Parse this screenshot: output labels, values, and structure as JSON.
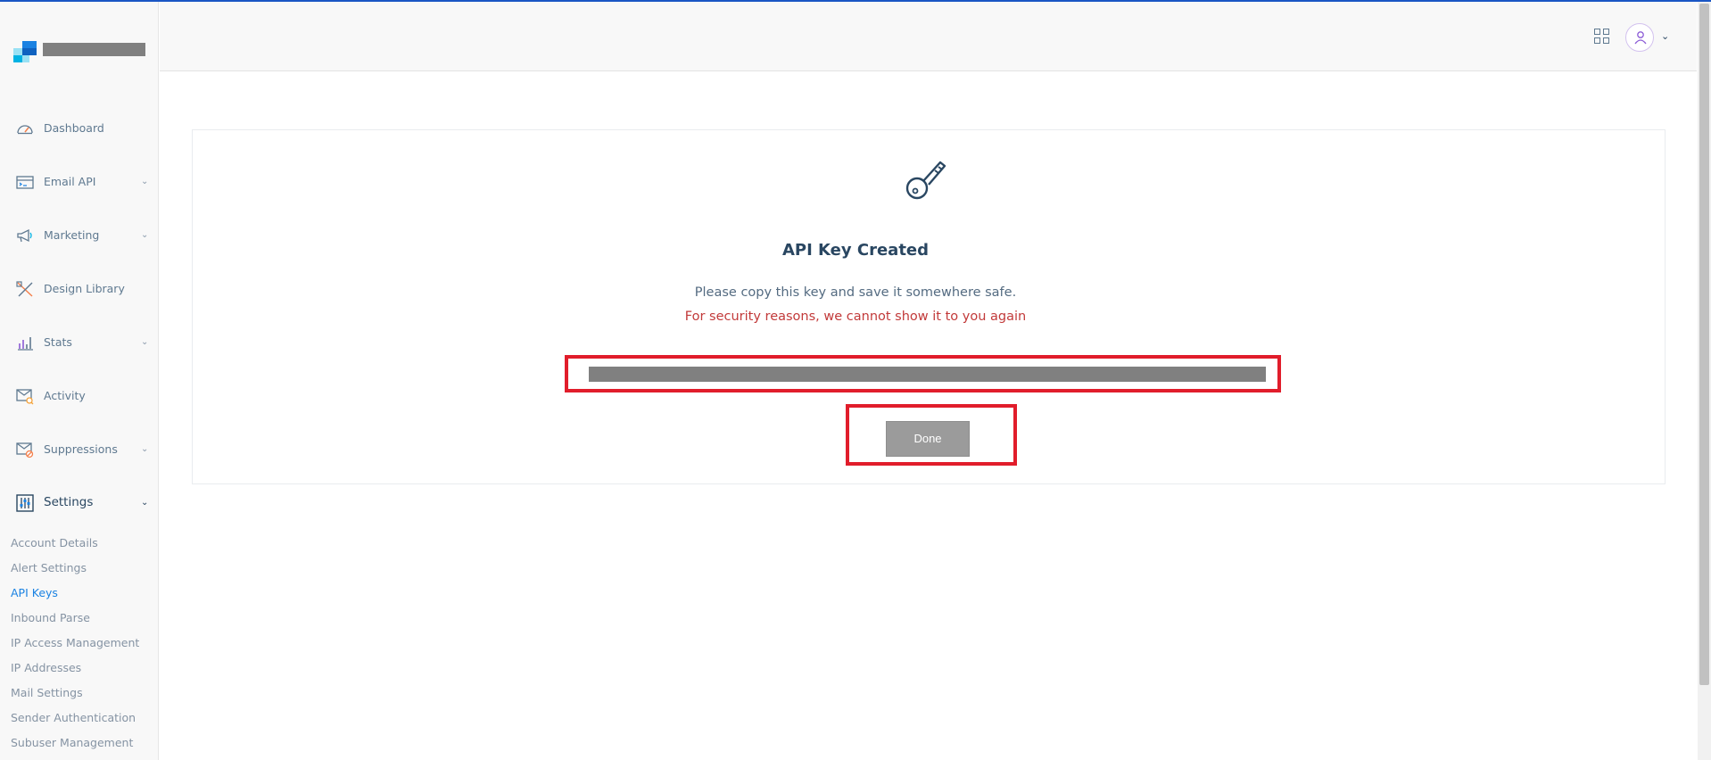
{
  "brand": {
    "logo_icon": "sendgrid-logo-icon"
  },
  "sidebar": {
    "items": [
      {
        "label": "Dashboard",
        "icon": "speedometer-icon"
      },
      {
        "label": "Email API",
        "icon": "email-api-icon"
      },
      {
        "label": "Marketing",
        "icon": "megaphone-icon"
      },
      {
        "label": "Design Library",
        "icon": "design-tools-icon"
      },
      {
        "label": "Stats",
        "icon": "stats-chart-icon"
      },
      {
        "label": "Activity",
        "icon": "envelope-search-icon"
      },
      {
        "label": "Suppressions",
        "icon": "envelope-blocked-icon"
      },
      {
        "label": "Settings",
        "icon": "sliders-icon"
      }
    ],
    "settings_subitems": [
      {
        "label": "Account Details"
      },
      {
        "label": "Alert Settings"
      },
      {
        "label": "API Keys"
      },
      {
        "label": "Inbound Parse"
      },
      {
        "label": "IP Access Management"
      },
      {
        "label": "IP Addresses"
      },
      {
        "label": "Mail Settings"
      },
      {
        "label": "Sender Authentication"
      },
      {
        "label": "Subuser Management"
      }
    ],
    "active_subitem": "API Keys"
  },
  "header": {
    "apps_icon": "grid-icon",
    "user_icon": "user-icon"
  },
  "card": {
    "icon": "key-icon",
    "title": "API Key Created",
    "message": "Please copy this key and save it somewhere safe.",
    "warning": "For security reasons, we cannot show it to you again",
    "done_label": "Done"
  },
  "colors": {
    "accent": "#1a82e2",
    "warning": "#c23a3a",
    "highlight": "#e11d2b",
    "button": "#9b9b9b"
  }
}
